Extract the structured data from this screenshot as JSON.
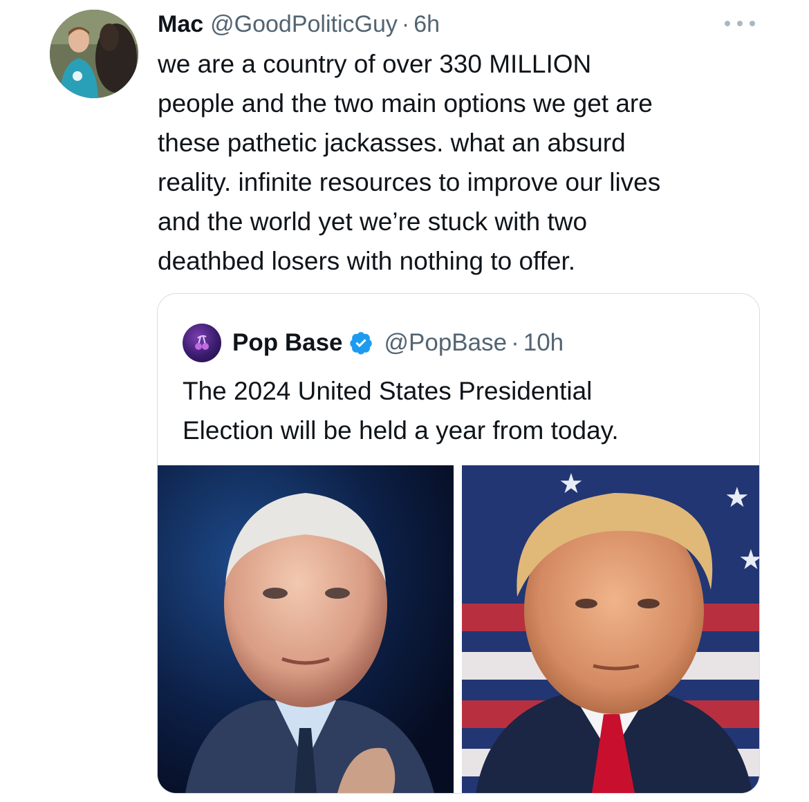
{
  "tweet": {
    "author_name": "Mac",
    "author_handle": "@GoodPoliticGuy",
    "separator": "·",
    "time": "6h",
    "text_lines": [
      "we are a country of over 330 MILLION",
      "people and the two main options we get are",
      "these pathetic jackasses. what an absurd",
      "reality. infinite resources to improve our lives",
      "and the world yet we’re stuck with two",
      "deathbed losers with nothing to offer."
    ]
  },
  "quote": {
    "author_name": "Pop Base",
    "author_handle": "@PopBase",
    "separator": "·",
    "time": "10h",
    "verified": true,
    "text_lines": [
      "The 2024 United States Presidential",
      "Election will be held a year from today."
    ]
  },
  "icons": {
    "more": "more-horizontal-icon",
    "verified": "verified-badge-icon"
  },
  "colors": {
    "text": "#0f1419",
    "secondary": "#536471",
    "verified": "#1d9bf0",
    "border": "#d5dde2"
  }
}
